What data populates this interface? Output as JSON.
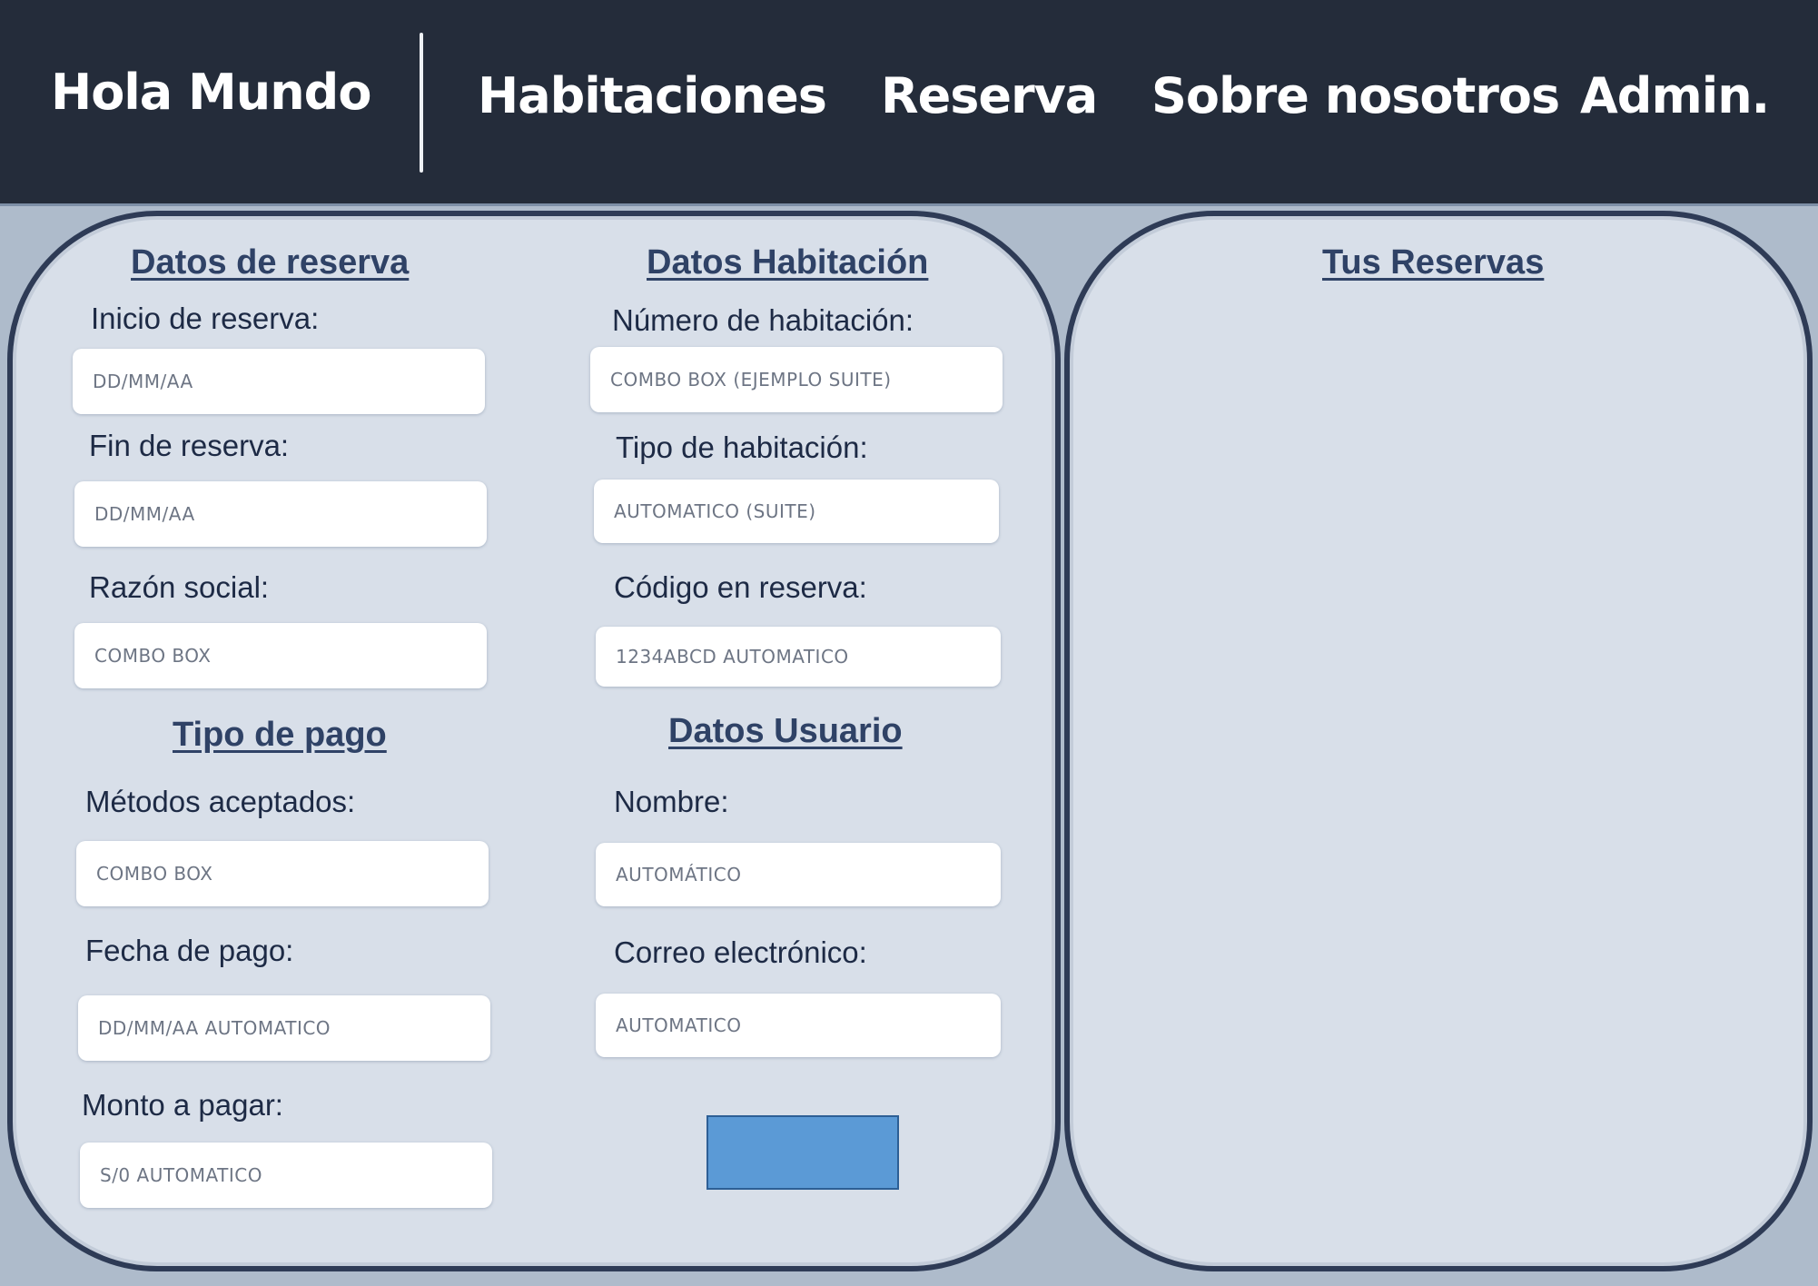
{
  "nav": {
    "brand": "Hola Mundo",
    "items": [
      "Habitaciones",
      "Reserva",
      "Sobre nosotros",
      "Admin."
    ]
  },
  "reserva": {
    "heading": "Datos de reserva",
    "inicio_label": "Inicio de reserva:",
    "inicio_placeholder": "DD/MM/AA",
    "fin_label": "Fin de reserva:",
    "fin_placeholder": "DD/MM/AA",
    "razon_label": "Razón social:",
    "razon_placeholder": "COMBO BOX"
  },
  "pago": {
    "heading": "Tipo de pago",
    "metodos_label": "Métodos aceptados:",
    "metodos_placeholder": "COMBO BOX",
    "fecha_label": "Fecha de pago:",
    "fecha_placeholder": "DD/MM/AA AUTOMATICO",
    "monto_label": "Monto a pagar:",
    "monto_placeholder": "S/0 AUTOMATICO"
  },
  "habitacion": {
    "heading": "Datos Habitación",
    "numero_label": "Número de habitación:",
    "numero_placeholder": "COMBO BOX (EJEMPLO SUITE)",
    "tipo_label": "Tipo de habitación:",
    "tipo_placeholder": "AUTOMATICO (SUITE)",
    "codigo_label": "Código en reserva:",
    "codigo_placeholder": "1234ABCD AUTOMATICO"
  },
  "usuario": {
    "heading": "Datos Usuario",
    "nombre_label": "Nombre:",
    "nombre_placeholder": "AUTOMÁTICO",
    "correo_label": "Correo electrónico:",
    "correo_placeholder": "AUTOMATICO"
  },
  "reservas": {
    "heading": "Tus Reservas"
  },
  "colors": {
    "topbar": "#242c3a",
    "background": "#aebbcb",
    "panel": "#d8dfe9",
    "panel_border": "#2e3b56",
    "heading": "#2f4266",
    "button": "#5b9ad6"
  }
}
